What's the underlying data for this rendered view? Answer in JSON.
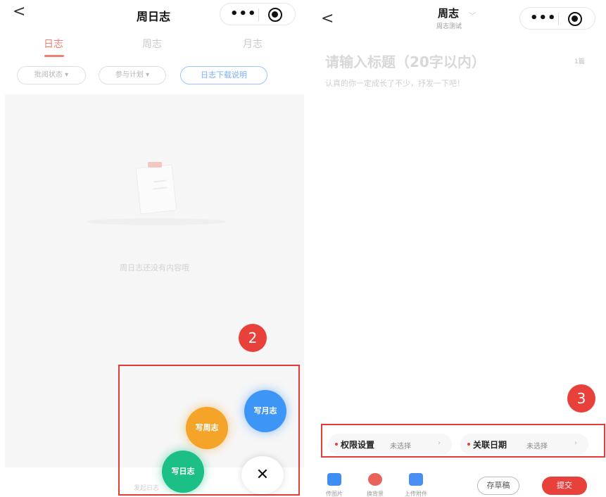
{
  "left_screen": {
    "nav": {
      "back_glyph": "<",
      "title": "周日志",
      "more_glyph": "•••"
    },
    "tabs": [
      {
        "label": "日志",
        "active": true
      },
      {
        "label": "周志",
        "active": false
      },
      {
        "label": "月志",
        "active": false
      }
    ],
    "filters": {
      "approval_status": "批阅状态 ▾",
      "participation_plan": "参与计划 ▾",
      "download_guide": "日志下载说明"
    },
    "empty_state": {
      "text": "周日志还没有内容哦"
    },
    "bottom_hint": "发起日志",
    "step_badge": "2",
    "fab": {
      "write_weekly": "写周志",
      "write_monthly": "写月志",
      "write_daily": "写日志",
      "close_glyph": "✕"
    },
    "colors": {
      "active_tab": "#f27f72",
      "weekly": "#f4a429",
      "monthly": "#3d95f5",
      "daily": "#1cbf86",
      "annotation_red": "#e43b36"
    }
  },
  "right_screen": {
    "nav": {
      "back_glyph": "<",
      "title": "周志",
      "subtitle": "周志测试",
      "chevron": "﹀",
      "more_glyph": "•••"
    },
    "title_placeholder": "请输入标题（20字以内）",
    "count_label": "1篇",
    "body_placeholder": "认真的你一定成长了不少，抒发一下吧！",
    "step_badge": "3",
    "settings": [
      {
        "label": "权限设置",
        "value": "未选择",
        "arrow": "›"
      },
      {
        "label": "关联日期",
        "value": "未选择",
        "arrow": "›"
      }
    ],
    "toolbar": {
      "image": "传图片",
      "background": "换背景",
      "attachment": "上传附件",
      "save_draft": "存草稿",
      "submit": "提交"
    },
    "colors": {
      "submit": "#e8403b",
      "required_dot": "#e8403b"
    }
  }
}
